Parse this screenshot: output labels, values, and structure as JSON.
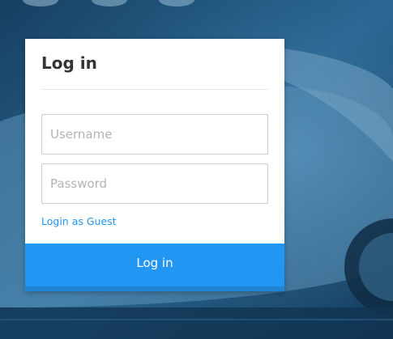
{
  "login": {
    "title": "Log in",
    "username_placeholder": "Username",
    "password_placeholder": "Password",
    "guest_link": "Login as Guest",
    "submit_label": "Log in"
  },
  "colors": {
    "background": "#1d4f75",
    "accent": "#2196f3",
    "card": "#ffffff"
  }
}
